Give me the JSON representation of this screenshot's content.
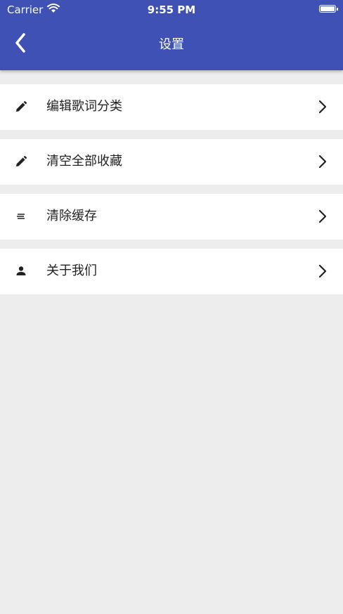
{
  "status_bar": {
    "carrier": "Carrier",
    "time": "9:55 PM"
  },
  "header": {
    "title": "设置",
    "back_icon": "back-chevron-icon"
  },
  "settings": [
    {
      "label": "编辑歌词分类",
      "icon": "pencil-icon"
    },
    {
      "label": "清空全部收藏",
      "icon": "pencil-icon"
    },
    {
      "label": "清除缓存",
      "icon": "lines-icon"
    },
    {
      "label": "关于我们",
      "icon": "person-icon"
    }
  ],
  "colors": {
    "appbar": "#3f51b5",
    "background": "#ededed",
    "row": "#ffffff"
  }
}
